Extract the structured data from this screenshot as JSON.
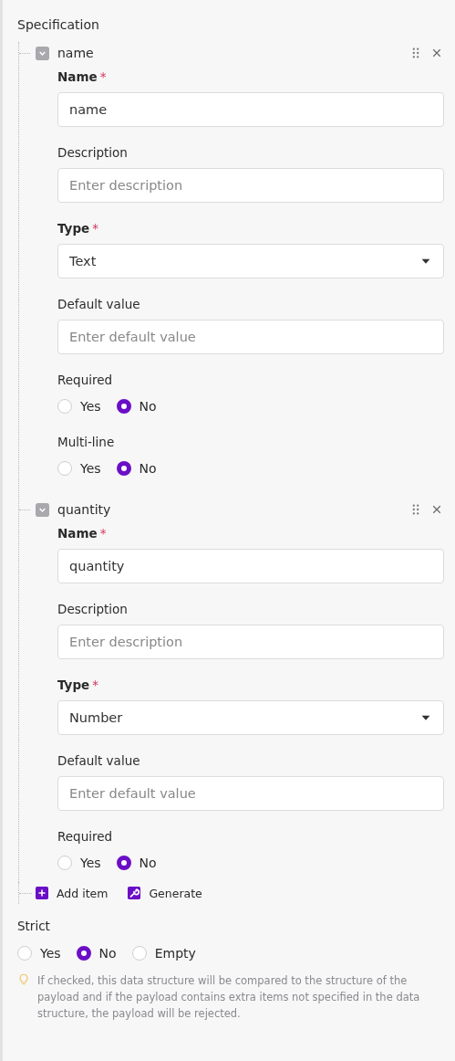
{
  "title": "Specification",
  "items": [
    {
      "name": "name",
      "expanded": true,
      "fields": [
        {
          "kind": "text",
          "label": "Name",
          "required": true,
          "marker": "*",
          "value": "name"
        },
        {
          "kind": "text",
          "label": "Description",
          "required": false,
          "placeholder": "Enter description"
        },
        {
          "kind": "select",
          "label": "Type",
          "required": true,
          "marker": "*",
          "value": "Text"
        },
        {
          "kind": "text",
          "label": "Default value",
          "required": false,
          "placeholder": "Enter default value"
        },
        {
          "kind": "radio",
          "label": "Required",
          "required": false,
          "options": [
            {
              "label": "Yes",
              "selected": false
            },
            {
              "label": "No",
              "selected": true
            }
          ]
        },
        {
          "kind": "radio",
          "label": "Multi-line",
          "required": false,
          "options": [
            {
              "label": "Yes",
              "selected": false
            },
            {
              "label": "No",
              "selected": true
            }
          ]
        }
      ]
    },
    {
      "name": "quantity",
      "expanded": true,
      "fields": [
        {
          "kind": "text",
          "label": "Name",
          "required": true,
          "marker": "*",
          "value": "quantity"
        },
        {
          "kind": "text",
          "label": "Description",
          "required": false,
          "placeholder": "Enter description"
        },
        {
          "kind": "select",
          "label": "Type",
          "required": true,
          "marker": "*",
          "value": "Number"
        },
        {
          "kind": "text",
          "label": "Default value",
          "required": false,
          "placeholder": "Enter default value"
        },
        {
          "kind": "radio",
          "label": "Required",
          "required": false,
          "options": [
            {
              "label": "Yes",
              "selected": false
            },
            {
              "label": "No",
              "selected": true
            }
          ]
        }
      ]
    }
  ],
  "actions": [
    {
      "kind": "add",
      "label": "Add item"
    },
    {
      "kind": "generate",
      "label": "Generate"
    }
  ],
  "strict": {
    "label": "Strict",
    "options": [
      {
        "label": "Yes",
        "selected": false
      },
      {
        "label": "No",
        "selected": true
      },
      {
        "label": "Empty",
        "selected": false
      }
    ],
    "hint": "If checked, this data structure will be compared to the structure of the payload and if the payload contains extra items not specified in the data structure, the payload will be rejected."
  }
}
